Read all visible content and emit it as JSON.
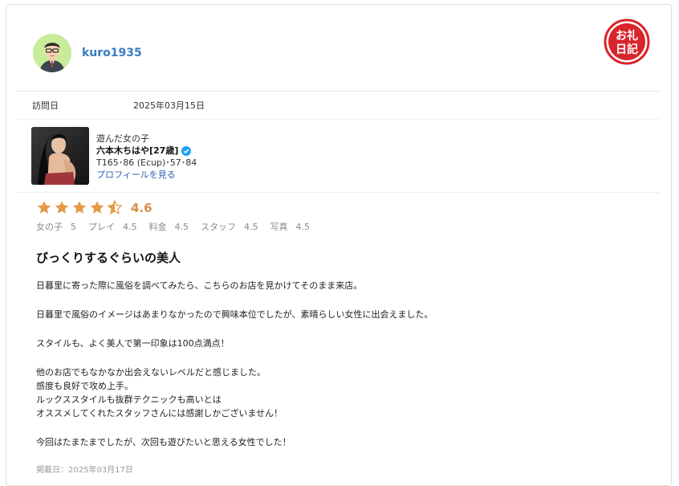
{
  "reviewer": {
    "name": "kuro1935"
  },
  "stamp": {
    "text_top": "お礼",
    "text_bottom": "日記",
    "color": "#d8252b"
  },
  "visit": {
    "label": "訪問日",
    "date": "2025年03月15日"
  },
  "girl": {
    "section_title": "遊んだ女の子",
    "name": "六本木ちはや[27歳]",
    "stats": "T165･86 (Ecup)･57･84",
    "profile_link": "プロフィールを見る",
    "verified_icon": "verified-check-icon"
  },
  "rating": {
    "overall": "4.6",
    "stars_value": 4.6,
    "star_color": "#e59a49",
    "items": [
      {
        "label": "女の子",
        "value": "5"
      },
      {
        "label": "プレイ",
        "value": "4.5"
      },
      {
        "label": "料金",
        "value": "4.5"
      },
      {
        "label": "スタッフ",
        "value": "4.5"
      },
      {
        "label": "写真",
        "value": "4.5"
      }
    ]
  },
  "review": {
    "title": "びっくりするぐらいの美人",
    "paragraphs": [
      "日暮里に寄った際に風俗を調べてみたら、こちらのお店を見かけてそのまま来店。",
      "日暮里で風俗のイメージはあまりなかったので興味本位でしたが、素晴らしい女性に出会えました。",
      "スタイルも、よく美人で第一印象は100点満点！",
      "他のお店でもなかなか出会えないレベルだと感じました。\n感度も良好で攻め上手。\nルックススタイルも抜群テクニックも高いとは\nオススメしてくれたスタッフさんには感謝しかございません！",
      "今回はたまたまでしたが、次回も遊びたいと思える女性でした！"
    ],
    "posted": "掲載日：2025年03月17日"
  }
}
